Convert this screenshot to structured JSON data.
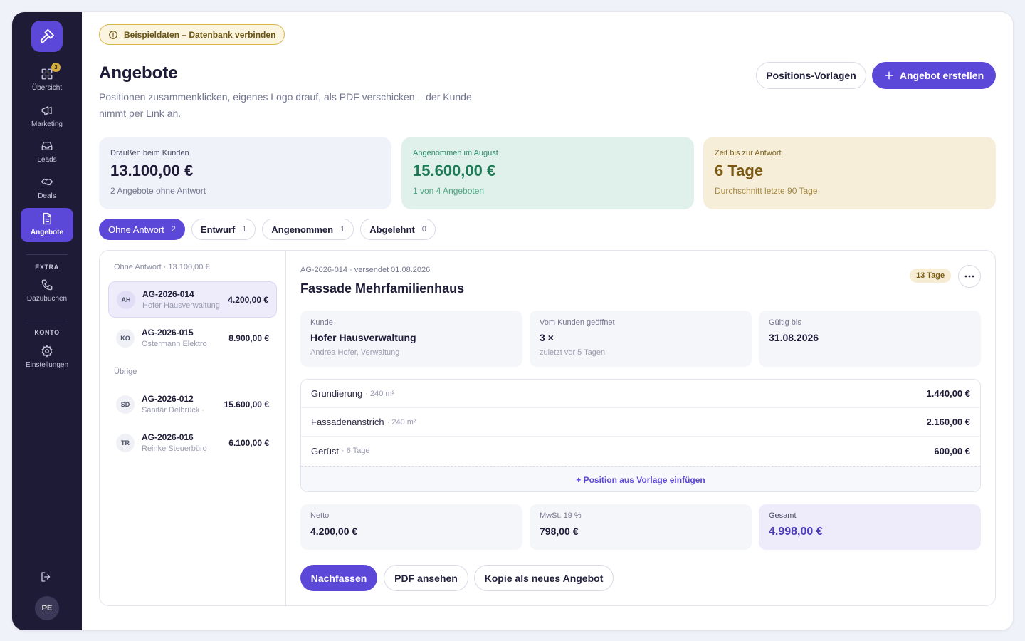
{
  "notice": {
    "label": "Beispieldaten – Datenbank verbinden"
  },
  "sidebar": {
    "items": [
      {
        "label": "Übersicht",
        "badge": "3",
        "icon": "grid-icon"
      },
      {
        "label": "Marketing",
        "icon": "megaphone-icon"
      },
      {
        "label": "Leads",
        "icon": "inbox-icon"
      },
      {
        "label": "Deals",
        "icon": "handshake-icon"
      },
      {
        "label": "Angebote",
        "icon": "document-icon",
        "active": true
      }
    ],
    "extra_section": "EXTRA",
    "extra_items": [
      {
        "label": "Dazubuchen",
        "icon": "phone-icon"
      }
    ],
    "account_section": "KONTO",
    "account_items": [
      {
        "label": "Einstellungen",
        "icon": "gear-icon"
      }
    ],
    "user_initials": "PE"
  },
  "header": {
    "title": "Angebote",
    "subtitle": "Positionen zusammenklicken, eigenes Logo drauf, als PDF verschicken – der Kunde nimmt per Link an.",
    "templates_button": "Positions-Vorlagen",
    "create_button": "Angebot erstellen"
  },
  "stats": [
    {
      "label": "Draußen beim Kunden",
      "value": "13.100,00 €",
      "sub": "2 Angebote ohne Antwort"
    },
    {
      "label": "Angenommen im August",
      "value": "15.600,00 €",
      "sub": "1 von 4 Angeboten"
    },
    {
      "label": "Zeit bis zur Antwort",
      "value": "6 Tage",
      "sub": "Durchschnitt letzte 90 Tage"
    }
  ],
  "tabs": [
    {
      "label": "Ohne Antwort",
      "count": "2",
      "active": true
    },
    {
      "label": "Entwurf",
      "count": "1"
    },
    {
      "label": "Angenommen",
      "count": "1"
    },
    {
      "label": "Abgelehnt",
      "count": "0"
    }
  ],
  "list": {
    "group1_title": "Ohne Antwort · 13.100,00 €",
    "group2_title": "Übrige",
    "offers": [
      {
        "initials": "AH",
        "number": "AG-2026-014",
        "customer": "Hofer Hausverwaltung",
        "amount": "4.200,00 €",
        "selected": true
      },
      {
        "initials": "KO",
        "number": "AG-2026-015",
        "customer": "Ostermann Elektro",
        "amount": "8.900,00 €"
      },
      {
        "initials": "SD",
        "number": "AG-2026-012",
        "customer": "Sanitär Delbrück · ",
        "amount": "15.600,00 €"
      },
      {
        "initials": "TR",
        "number": "AG-2026-016",
        "customer": "Reinke Steuerbüro",
        "amount": "6.100,00 €"
      }
    ]
  },
  "detail": {
    "meta": "AG-2026-014 · versendet 01.08.2026",
    "title": "Fassade Mehrfamilienhaus",
    "days_badge": "13 Tage",
    "info": [
      {
        "key": "Kunde",
        "value": "Hofer Hausverwaltung",
        "hint": "Andrea Hofer, Verwaltung"
      },
      {
        "key": "Vom Kunden geöffnet",
        "value": "3 ×",
        "hint": "zuletzt vor 5 Tagen"
      },
      {
        "key": "Gültig bis",
        "value": "31.08.2026",
        "hint": ""
      }
    ],
    "positions": [
      {
        "name": "Grundierung",
        "qty": "· 240 m²",
        "price": "1.440,00 €"
      },
      {
        "name": "Fassadenanstrich",
        "qty": "· 240 m²",
        "price": "2.160,00 €"
      },
      {
        "name": "Gerüst",
        "qty": "· 6 Tage",
        "price": "600,00 €"
      }
    ],
    "add_position": "+ Position aus Vorlage einfügen",
    "totals": [
      {
        "key": "Netto",
        "value": "4.200,00 €"
      },
      {
        "key": "MwSt. 19 %",
        "value": "798,00 €"
      },
      {
        "key": "Gesamt",
        "value": "4.998,00 €"
      }
    ],
    "actions": {
      "follow_up": "Nachfassen",
      "view_pdf": "PDF ansehen",
      "copy": "Kopie als neues Angebot"
    }
  },
  "colors": {
    "accent": "#5b48d9",
    "sidebar": "#1e1b36",
    "success": "#1f7a58",
    "warning": "#7a5a12"
  }
}
